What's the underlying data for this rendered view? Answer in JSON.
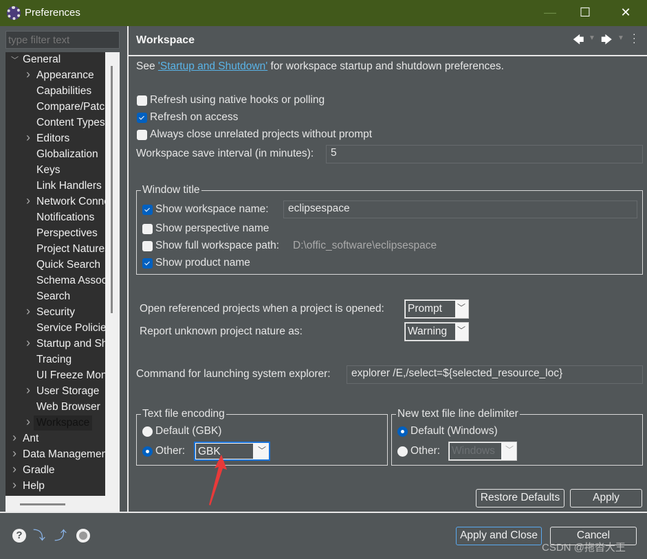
{
  "window": {
    "title": "Preferences",
    "minimize": "—",
    "maximize": "☐",
    "close": "✕"
  },
  "filter": {
    "placeholder": "type filter text"
  },
  "tree": {
    "general": "General",
    "children": [
      {
        "label": "Appearance",
        "expandable": true
      },
      {
        "label": "Capabilities",
        "expandable": false
      },
      {
        "label": "Compare/Patch",
        "expandable": false
      },
      {
        "label": "Content Types",
        "expandable": false
      },
      {
        "label": "Editors",
        "expandable": true
      },
      {
        "label": "Globalization",
        "expandable": false
      },
      {
        "label": "Keys",
        "expandable": false
      },
      {
        "label": "Link Handlers",
        "expandable": false
      },
      {
        "label": "Network Connections",
        "expandable": true
      },
      {
        "label": "Notifications",
        "expandable": false
      },
      {
        "label": "Perspectives",
        "expandable": false
      },
      {
        "label": "Project Natures",
        "expandable": false
      },
      {
        "label": "Quick Search",
        "expandable": false
      },
      {
        "label": "Schema Associations",
        "expandable": false
      },
      {
        "label": "Search",
        "expandable": false
      },
      {
        "label": "Security",
        "expandable": true
      },
      {
        "label": "Service Policies",
        "expandable": false
      },
      {
        "label": "Startup and Shutdown",
        "expandable": true
      },
      {
        "label": "Tracing",
        "expandable": false
      },
      {
        "label": "UI Freeze Monitoring",
        "expandable": false
      },
      {
        "label": "User Storage",
        "expandable": true
      },
      {
        "label": "Web Browser",
        "expandable": false
      },
      {
        "label": "Workspace",
        "expandable": true,
        "selected": true
      }
    ],
    "top": [
      "Ant",
      "Data Management",
      "Gradle",
      "Help"
    ]
  },
  "page": {
    "title": "Workspace",
    "see_prefix": "See ",
    "see_link": "'Startup and Shutdown'",
    "see_suffix": " for workspace startup and shutdown preferences.",
    "refresh_native": {
      "label": "Refresh using native hooks or polling",
      "checked": false
    },
    "refresh_access": {
      "label": "Refresh on access",
      "checked": true
    },
    "always_close": {
      "label": "Always close unrelated projects without prompt",
      "checked": false
    },
    "save_interval_label": "Workspace save interval (in minutes):",
    "save_interval_value": "5",
    "window_title": {
      "legend": "Window title",
      "show_ws_name": {
        "label": "Show workspace name:",
        "checked": true,
        "value": "eclipsespace"
      },
      "show_perspective": {
        "label": "Show perspective name",
        "checked": false
      },
      "show_full_path": {
        "label": "Show full workspace path:",
        "checked": false,
        "value": "D:\\offic_software\\eclipsespace"
      },
      "show_product": {
        "label": "Show product name",
        "checked": true
      }
    },
    "open_ref_label": "Open referenced projects when a project is opened:",
    "open_ref_value": "Prompt",
    "report_label": "Report unknown project nature as:",
    "report_value": "Warning",
    "explorer_label": "Command for launching system explorer:",
    "explorer_value": "explorer /E,/select=${selected_resource_loc}",
    "encoding": {
      "legend": "Text file encoding",
      "default": "Default (GBK)",
      "other": "Other:",
      "other_value": "GBK",
      "selected": "other"
    },
    "delimiter": {
      "legend": "New text file line delimiter",
      "default": "Default (Windows)",
      "other": "Other:",
      "other_value": "Windows",
      "selected": "default"
    },
    "restore": "Restore Defaults",
    "apply": "Apply"
  },
  "footer": {
    "apply_close": "Apply and Close",
    "cancel": "Cancel",
    "watermark": "CSDN @拖沓大王"
  },
  "colors": {
    "titlebar": "#41591b",
    "background": "#515658",
    "accent": "#0060c0",
    "link": "#5ab4e8",
    "annotation_arrow": "#e83a3a"
  }
}
